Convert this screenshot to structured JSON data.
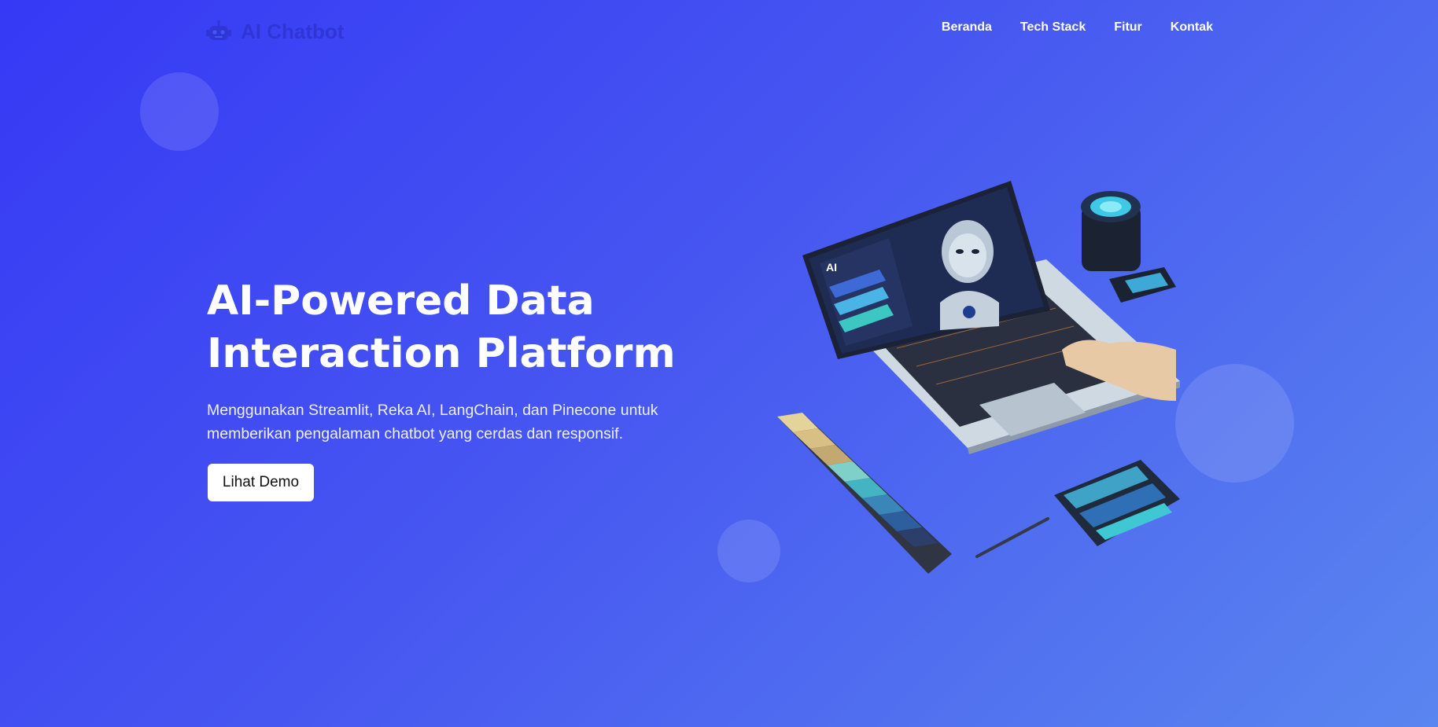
{
  "nav": {
    "logo_icon": "robot-icon",
    "logo_text": "AI Chatbot",
    "links": [
      "Beranda",
      "Tech Stack",
      "Fitur",
      "Kontak"
    ]
  },
  "hero": {
    "title_line1": "AI-Powered Data",
    "title_line2": "Interaction Platform",
    "subtitle_line1": "Menggunakan Streamlit, Reka AI, LangChain, dan Pinecone untuk",
    "subtitle_line2": "memberikan pengalaman chatbot yang cerdas dan responsif.",
    "cta_label": "Lihat Demo"
  },
  "colors": {
    "gradient_start": "#3639f5",
    "gradient_end": "#5a86f0",
    "logo": "#3036d6",
    "button_bg": "#ffffff"
  }
}
